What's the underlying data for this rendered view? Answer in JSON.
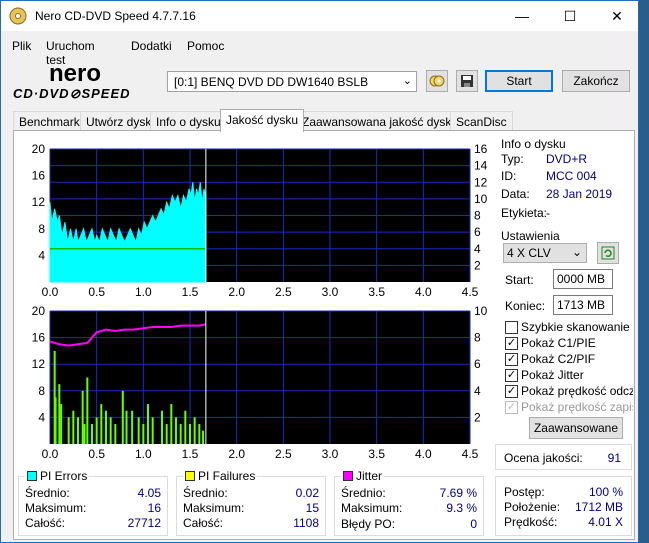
{
  "window": {
    "title": "Nero CD-DVD Speed 4.7.7.16",
    "minimize": "—",
    "maximize": "☐",
    "close": "✕"
  },
  "menu": [
    "Plik",
    "Uruchom test",
    "Dodatki",
    "Pomoc"
  ],
  "toolbar": {
    "drive": "[0:1]   BENQ DVD DD DW1640 BSLB",
    "start_label": "Start",
    "exit_label": "Zakończ"
  },
  "tabs": [
    "Benchmark",
    "Utwórz dysk",
    "Info o dysku",
    "Jakość dysku",
    "Zaawansowana jakość dysku",
    "ScanDisc"
  ],
  "active_tab": 3,
  "disc_info": {
    "title": "Info o dysku",
    "type_label": "Typ:",
    "type_value": "DVD+R",
    "id_label": "ID:",
    "id_value": "MCC 004",
    "date_label": "Data:",
    "date_value": "28 Jan 2019",
    "label_label": "Etykieta:",
    "label_value": "-"
  },
  "settings": {
    "title": "Ustawienia",
    "speed": "4 X CLV",
    "start_label": "Start:",
    "start_value": "0000 MB",
    "end_label": "Koniec:",
    "end_value": "1713 MB",
    "checkboxes": [
      {
        "label": "Szybkie skanowanie",
        "checked": false,
        "enabled": true
      },
      {
        "label": "Pokaż C1/PIE",
        "checked": true,
        "enabled": true
      },
      {
        "label": "Pokaż C2/PIF",
        "checked": true,
        "enabled": true
      },
      {
        "label": "Pokaż Jitter",
        "checked": true,
        "enabled": true
      },
      {
        "label": "Pokaż prędkość odczyt",
        "checked": true,
        "enabled": true
      },
      {
        "label": "Pokaż prędkość zapisu",
        "checked": true,
        "enabled": false
      }
    ],
    "advanced_label": "Zaawansowane"
  },
  "quality": {
    "label": "Ocena jakości:",
    "value": "91"
  },
  "progress": {
    "progress_label": "Postęp:",
    "progress_value": "100 %",
    "position_label": "Położenie:",
    "position_value": "1712 MB",
    "speed_label": "Prędkość:",
    "speed_value": "4.01 X"
  },
  "stats": {
    "pi_errors": {
      "title": "PI Errors",
      "color": "#00ffff",
      "avg_label": "Średnio:",
      "avg": "4.05",
      "max_label": "Maksimum:",
      "max": "16",
      "total_label": "Całość:",
      "total": "27712"
    },
    "pi_failures": {
      "title": "PI Failures",
      "color": "#ffff00",
      "avg_label": "Średnio:",
      "avg": "0.02",
      "max_label": "Maksimum:",
      "max": "15",
      "total_label": "Całość:",
      "total": "1108"
    },
    "jitter": {
      "title": "Jitter",
      "color": "#ff00ff",
      "avg_label": "Średnio:",
      "avg": "7.69 %",
      "max_label": "Maksimum:",
      "max": "9.3 %",
      "po_label": "Błędy PO:",
      "po": "0"
    }
  },
  "chart_data": [
    {
      "type": "area",
      "name": "PI Errors / read speed",
      "x_ticks": [
        "0.0",
        "0.5",
        "1.0",
        "1.5",
        "2.0",
        "2.5",
        "3.0",
        "3.5",
        "4.0",
        "4.5"
      ],
      "xlim": [
        0,
        4.5
      ],
      "y_left_ticks": [
        "20",
        "16",
        "12",
        "8",
        "4"
      ],
      "ylim_left": [
        0,
        20
      ],
      "y_right_ticks": [
        "16",
        "14",
        "12",
        "10",
        "8",
        "6",
        "4",
        "2"
      ],
      "ylim_right": [
        0,
        16
      ],
      "scan_end": 1.67,
      "pie_color": "#00ffff",
      "speed_color": "#00c000",
      "speed_value": 4.0,
      "pie_profile": [
        [
          0.0,
          12
        ],
        [
          0.02,
          9
        ],
        [
          0.05,
          11
        ],
        [
          0.08,
          9
        ],
        [
          0.1,
          10
        ],
        [
          0.13,
          7
        ],
        [
          0.16,
          9
        ],
        [
          0.19,
          6
        ],
        [
          0.22,
          8
        ],
        [
          0.25,
          6
        ],
        [
          0.28,
          8
        ],
        [
          0.3,
          6
        ],
        [
          0.33,
          7
        ],
        [
          0.36,
          8
        ],
        [
          0.39,
          6
        ],
        [
          0.42,
          7
        ],
        [
          0.45,
          8
        ],
        [
          0.48,
          6
        ],
        [
          0.5,
          7
        ],
        [
          0.53,
          6
        ],
        [
          0.56,
          8
        ],
        [
          0.59,
          7
        ],
        [
          0.62,
          6
        ],
        [
          0.65,
          8
        ],
        [
          0.68,
          7
        ],
        [
          0.71,
          6
        ],
        [
          0.74,
          8
        ],
        [
          0.77,
          7
        ],
        [
          0.8,
          6
        ],
        [
          0.83,
          7
        ],
        [
          0.86,
          8
        ],
        [
          0.89,
          7
        ],
        [
          0.92,
          6
        ],
        [
          0.95,
          8
        ],
        [
          0.98,
          7
        ],
        [
          1.01,
          9
        ],
        [
          1.04,
          8
        ],
        [
          1.07,
          9
        ],
        [
          1.1,
          10
        ],
        [
          1.13,
          9
        ],
        [
          1.16,
          10
        ],
        [
          1.19,
          11
        ],
        [
          1.22,
          10
        ],
        [
          1.25,
          12
        ],
        [
          1.28,
          11
        ],
        [
          1.31,
          13
        ],
        [
          1.34,
          12
        ],
        [
          1.37,
          13
        ],
        [
          1.4,
          11
        ],
        [
          1.43,
          13
        ],
        [
          1.46,
          12
        ],
        [
          1.49,
          14
        ],
        [
          1.51,
          13
        ],
        [
          1.53,
          15
        ],
        [
          1.55,
          12
        ],
        [
          1.57,
          14
        ],
        [
          1.59,
          13
        ],
        [
          1.61,
          15
        ],
        [
          1.63,
          12
        ],
        [
          1.65,
          14
        ],
        [
          1.67,
          13
        ]
      ]
    },
    {
      "type": "bar",
      "name": "PI Failures / jitter",
      "x_ticks": [
        "0.0",
        "0.5",
        "1.0",
        "1.5",
        "2.0",
        "2.5",
        "3.0",
        "3.5",
        "4.0",
        "4.5"
      ],
      "xlim": [
        0,
        4.5
      ],
      "y_left_ticks": [
        "20",
        "16",
        "12",
        "8",
        "4"
      ],
      "ylim_left": [
        0,
        20
      ],
      "y_right_ticks": [
        "10",
        "8",
        "6",
        "4",
        "2"
      ],
      "ylim_right": [
        0,
        10
      ],
      "scan_end": 1.67,
      "pif_color": "#66ff00",
      "jitter_color": "#ff00ff",
      "pif_bars": [
        [
          0.05,
          14
        ],
        [
          0.06,
          7
        ],
        [
          0.1,
          9
        ],
        [
          0.12,
          6
        ],
        [
          0.2,
          4
        ],
        [
          0.25,
          5
        ],
        [
          0.3,
          4
        ],
        [
          0.35,
          8
        ],
        [
          0.37,
          3
        ],
        [
          0.4,
          10
        ],
        [
          0.45,
          3
        ],
        [
          0.5,
          4
        ],
        [
          0.55,
          6
        ],
        [
          0.6,
          5
        ],
        [
          0.65,
          4
        ],
        [
          0.7,
          3
        ],
        [
          0.78,
          8
        ],
        [
          0.82,
          5
        ],
        [
          0.88,
          5
        ],
        [
          0.95,
          4
        ],
        [
          1.0,
          3
        ],
        [
          1.05,
          6
        ],
        [
          1.1,
          4
        ],
        [
          1.2,
          5
        ],
        [
          1.25,
          3
        ],
        [
          1.3,
          6
        ],
        [
          1.35,
          4
        ],
        [
          1.4,
          3
        ],
        [
          1.45,
          5
        ],
        [
          1.5,
          3
        ],
        [
          1.55,
          4
        ],
        [
          1.6,
          3
        ],
        [
          1.64,
          2
        ]
      ],
      "jitter_profile": [
        [
          0.0,
          7.7
        ],
        [
          0.1,
          7.5
        ],
        [
          0.2,
          7.4
        ],
        [
          0.3,
          7.5
        ],
        [
          0.4,
          7.6
        ],
        [
          0.5,
          8.4
        ],
        [
          0.6,
          8.6
        ],
        [
          0.7,
          8.5
        ],
        [
          0.8,
          8.6
        ],
        [
          0.9,
          8.6
        ],
        [
          1.0,
          8.7
        ],
        [
          1.1,
          8.8
        ],
        [
          1.2,
          8.8
        ],
        [
          1.3,
          8.8
        ],
        [
          1.4,
          8.9
        ],
        [
          1.5,
          8.9
        ],
        [
          1.6,
          8.9
        ],
        [
          1.67,
          9.0
        ]
      ]
    }
  ]
}
